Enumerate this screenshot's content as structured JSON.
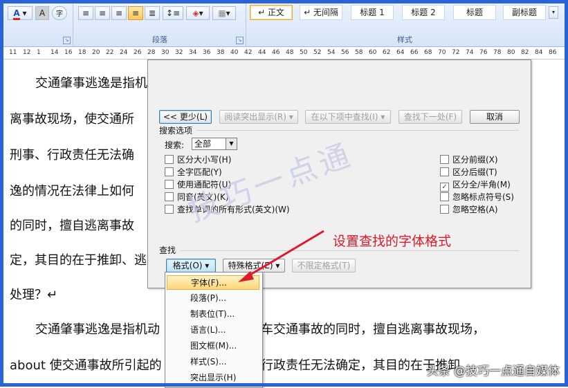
{
  "ribbon": {
    "paragraph_group_label": "段落",
    "styles_group_label": "样式",
    "font_color_glyph": "A",
    "char_shading_glyph": "A",
    "enclosed_char_glyph": "字",
    "styles": [
      "↵ 正文",
      "↵ 无间隔",
      "标题 1",
      "标题 2",
      "标题",
      "副标题"
    ]
  },
  "ruler": [
    "11",
    "12",
    "1",
    "14",
    "16",
    "18",
    "20",
    "22",
    "24",
    "26",
    "28",
    "30",
    "32",
    "34",
    "36",
    "38",
    "40",
    "42",
    "44",
    "46",
    "48",
    "50",
    "52",
    "54",
    "56",
    "58",
    "60",
    "62",
    "64",
    "66",
    "68",
    "70",
    "72",
    "74",
    "76",
    "78",
    "80",
    "82",
    "84",
    "86"
  ],
  "ruler_labels": [
    "11",
    "12",
    "1",
    "14",
    "16",
    "18",
    "20",
    "22",
    "24",
    "26",
    "28",
    "30",
    "32",
    "34",
    "36",
    "38",
    "40",
    "42",
    "44",
    "46",
    "48",
    "50",
    "52",
    "54",
    "56",
    "58",
    "60",
    "62",
    "64",
    "66",
    "68",
    "70",
    "72",
    "74",
    "76",
    "78",
    "80",
    "82",
    "84",
    "86"
  ],
  "document": {
    "lines": [
      "交通肇事逃逸是指机",
      "离事故现场，使交通所",
      "刑事、行政责任无法确",
      "逸的情况在法律上如何",
      "的同时，擅自逃离事故",
      "定，其目的在于推卸、逃",
      "处理？↵",
      "交通肇事逃逸是指机动",
      "车交通事故的同时，擅自逃离事故现场，",
      "about 使交通事故所引起的",
      "行政责任无法确定，其目的在于推卸"
    ]
  },
  "dialog": {
    "less_button": "<< 更少(L)",
    "reading_highlight": "阅读突出显示(R) ▾",
    "find_in": "在以下项中查找(I) ▾",
    "find_next": "查找下一处(F)",
    "cancel": "取消",
    "search_options_label": "搜索选项",
    "search_label": "搜索",
    "search_value": "全部",
    "left_options": [
      {
        "label": "区分大小写(H)",
        "checked": false
      },
      {
        "label": "全字匹配(Y)",
        "checked": false
      },
      {
        "label": "使用通配符(U)",
        "checked": false
      },
      {
        "label": "同音(英文)(K)",
        "checked": false
      },
      {
        "label": "查找单词的所有形式(英文)(W)",
        "checked": false
      }
    ],
    "right_options": [
      {
        "label": "区分前缀(X)",
        "checked": false
      },
      {
        "label": "区分后缀(T)",
        "checked": false
      },
      {
        "label": "区分全/半角(M)",
        "checked": true
      },
      {
        "label": "忽略标点符号(S)",
        "checked": false
      },
      {
        "label": "忽略空格(A)",
        "checked": false
      }
    ],
    "find_label": "查找",
    "format_button": "格式(O) ▾",
    "special_button": "特殊格式(E) ▾",
    "no_format_button": "不限定格式(T)"
  },
  "format_menu": {
    "items": [
      "字体(F)...",
      "段落(P)...",
      "制表位(T)...",
      "语言(L)...",
      "图文框(M)...",
      "样式(S)...",
      "突出显示(H)"
    ],
    "highlighted_index": 0
  },
  "annotation": "设置查找的字体格式",
  "watermark": "技巧一点通",
  "credit": "头条 @技巧一点通自媒体",
  "colors": {
    "annotation": "#e0192a",
    "frame": "#2a62d8",
    "menu_highlight": "#ffd774"
  }
}
